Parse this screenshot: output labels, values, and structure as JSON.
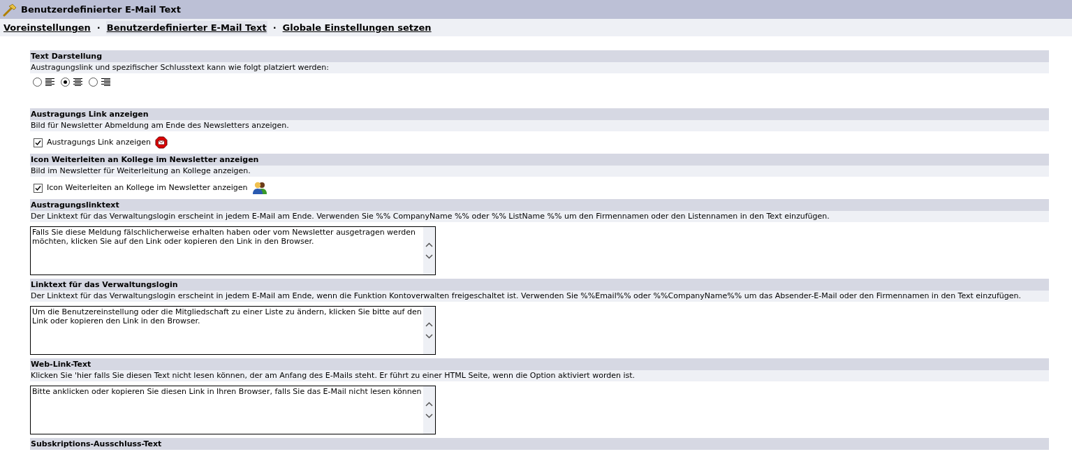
{
  "window": {
    "title": "Benutzerdefinierter E-Mail Text"
  },
  "nav_separators": [
    "·",
    "·"
  ],
  "nav": [
    {
      "label": "Voreinstellungen",
      "selected": false
    },
    {
      "label": "Benutzerdefinierter E-Mail Text",
      "selected": true
    },
    {
      "label": "Globale Einstellungen setzen",
      "selected": false
    }
  ],
  "sections": [
    {
      "kind": "radio",
      "title": "Text Darstellung",
      "description": "Austragungslink und spezifischer Schlusstext kann wie folgt platziert werden:",
      "options": [
        {
          "selected": false
        },
        {
          "selected": true
        },
        {
          "selected": false
        }
      ]
    },
    {
      "kind": "checkbox",
      "title": "Austragungs Link anzeigen",
      "description": "Bild für Newsletter Abmeldung am Ende des Newsletters anzeigen.",
      "label": "Austragungs Link anzeigen",
      "checked": true
    },
    {
      "kind": "checkbox",
      "title": "Icon Weiterleiten an Kollege im Newsletter anzeigen",
      "description": "Bild im Newsletter für Weiterleitung an Kollege anzeigen.",
      "label": "Icon Weiterleiten an Kollege im Newsletter anzeigen",
      "checked": true
    },
    {
      "kind": "textarea",
      "title": "Austragungslinktext",
      "description": "Der Linktext für das Verwaltungslogin erscheint in jedem E-Mail am Ende. Verwenden Sie %% CompanyName %% oder %% ListName %% um den Firmennamen oder den Listennamen in den Text einzufügen.",
      "value": "Falls Sie diese Meldung fälschlicherweise erhalten haben oder vom Newsletter ausgetragen werden möchten, klicken Sie auf den Link oder kopieren den Link in den Browser."
    },
    {
      "kind": "textarea",
      "title": "Linktext für das Verwaltungslogin",
      "description": "Der Linktext für das Verwaltungslogin erscheint in jedem E-Mail am Ende, wenn die Funktion Kontoverwalten freigeschaltet ist. Verwenden Sie %%Email%% oder %%CompanyName%% um das Absender-E-Mail oder den Firmennamen in den Text einzufügen.",
      "value": "Um die Benutzereinstellung oder die Mitgliedschaft zu einer Liste zu ändern, klicken Sie bitte auf den Link oder kopieren den Link in den Browser."
    },
    {
      "kind": "textarea",
      "title": "Web-Link-Text",
      "description": "Klicken Sie 'hier falls Sie diesen Text nicht lesen können, der am Anfang des E-Mails steht. Er führt zu einer HTML Seite, wenn die Option aktiviert worden ist.",
      "value": "Bitte anklicken oder kopieren Sie diesen Link in Ihren Browser, falls Sie das E-Mail nicht lesen können"
    },
    {
      "kind": "heading",
      "title": "Subskriptions-Ausschluss-Text"
    }
  ]
}
